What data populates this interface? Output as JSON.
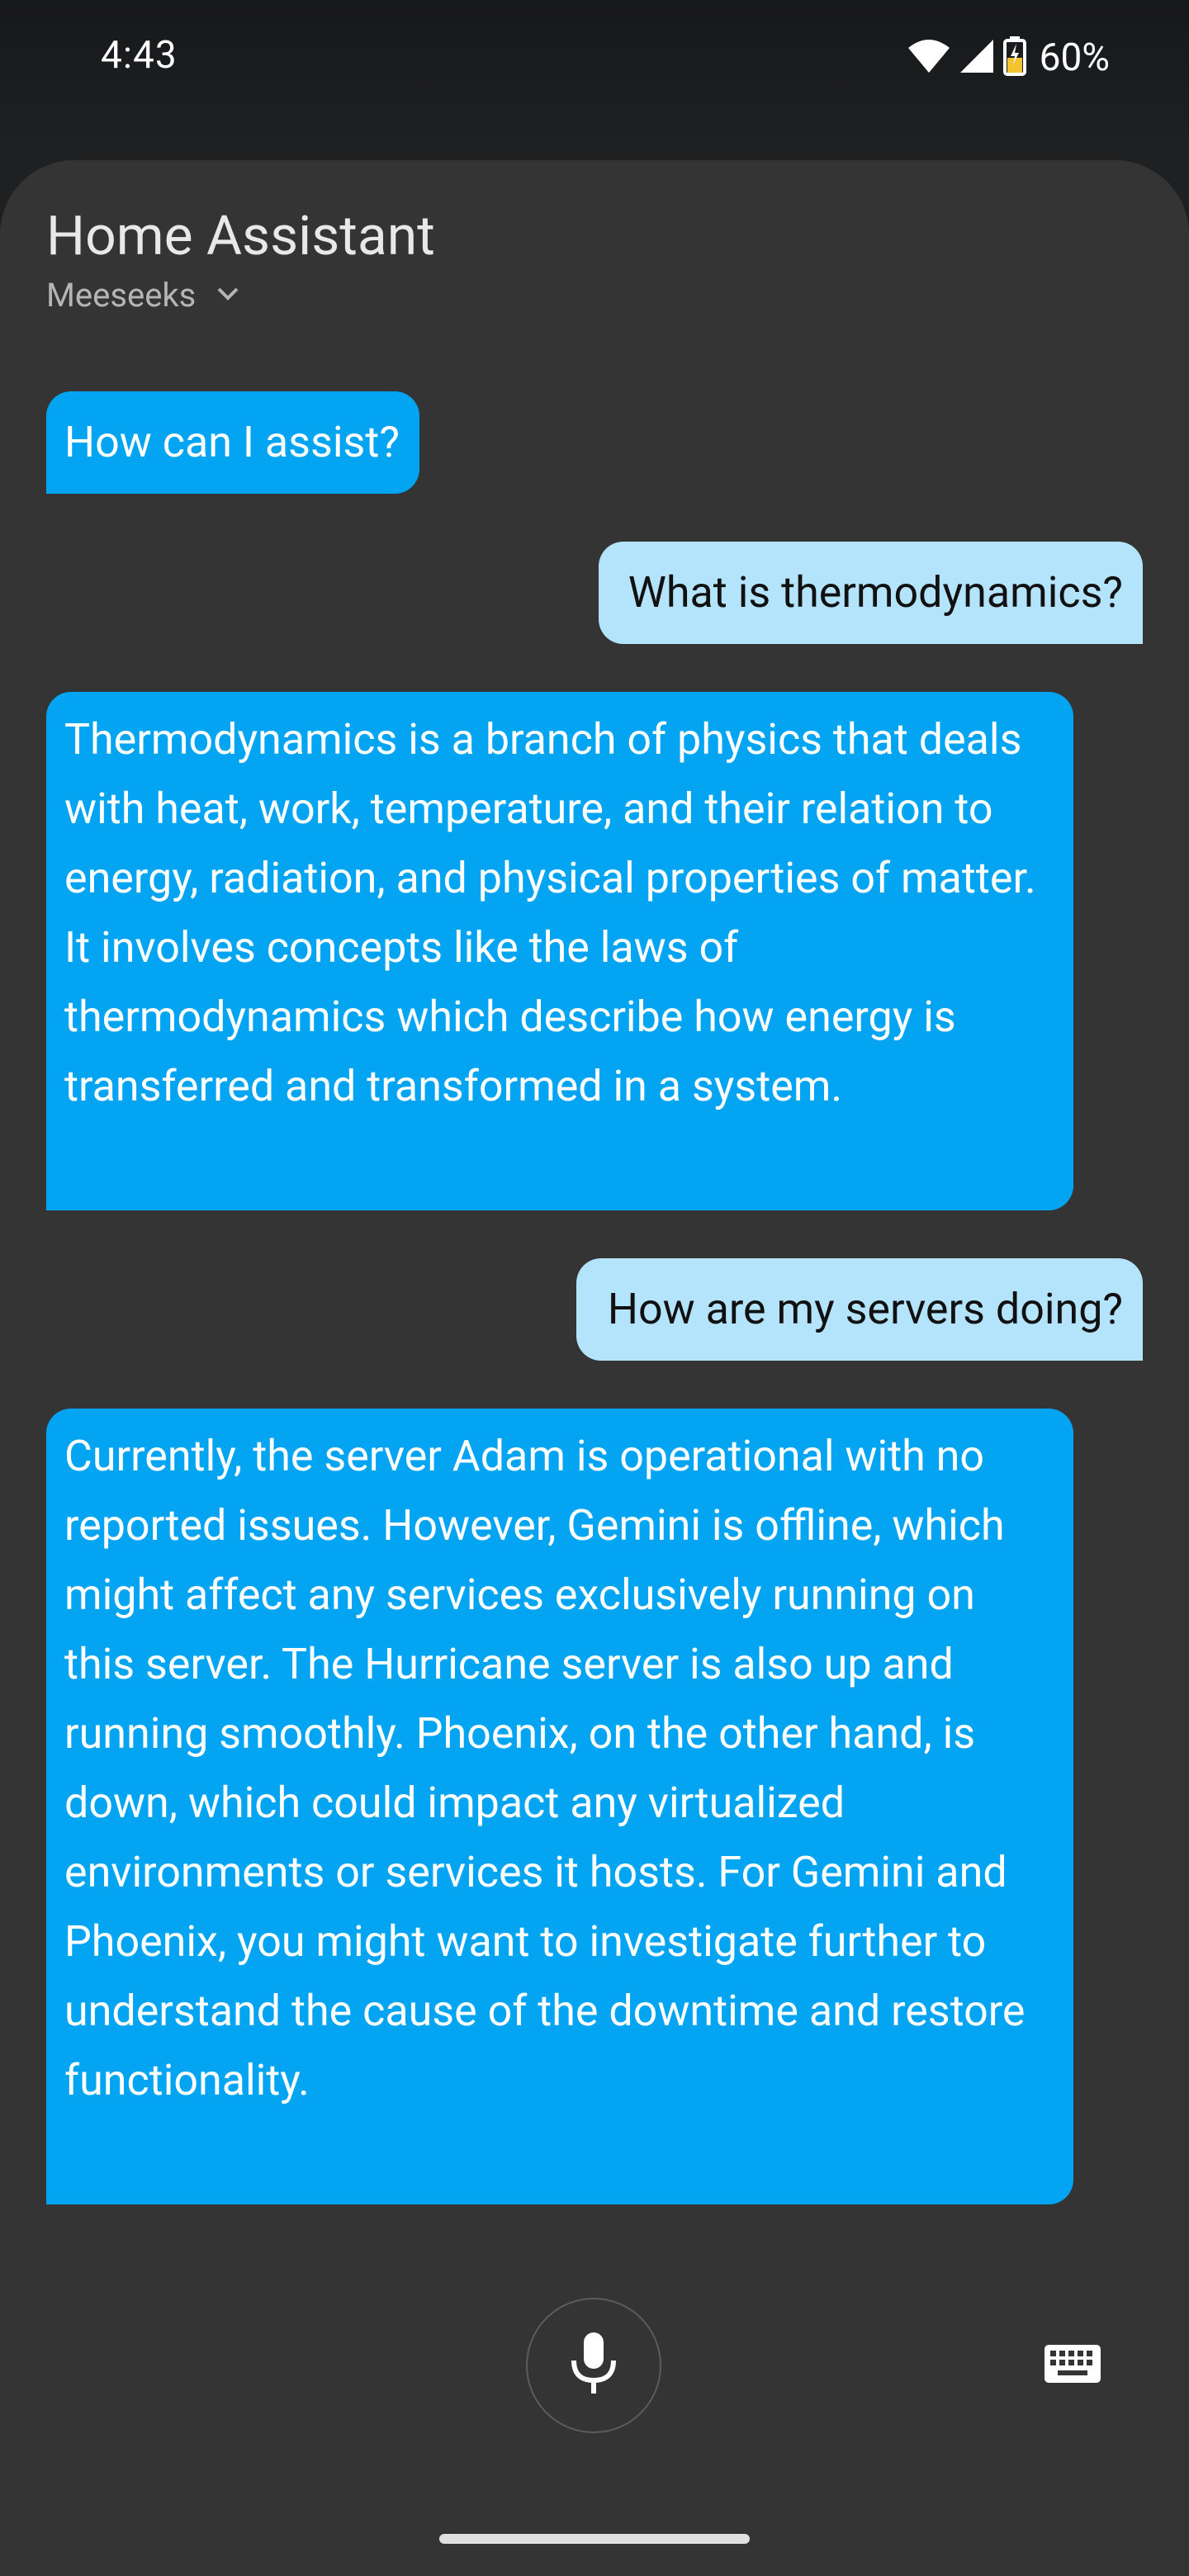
{
  "status_bar": {
    "time": "4:43",
    "battery_percent": "60%",
    "icons": [
      "wifi-icon",
      "cell-signal-icon",
      "battery-charging-icon"
    ]
  },
  "header": {
    "title": "Home Assistant",
    "pipeline": "Meeseeks",
    "dropdown_icon": "chevron-down-icon"
  },
  "conversation": [
    {
      "role": "assistant",
      "text": "How can I assist?"
    },
    {
      "role": "user",
      "text": "What is thermodynamics?"
    },
    {
      "role": "assistant",
      "text": "Thermodynamics is a branch of physics that deals with heat, work, temperature, and their relation to energy, radiation, and physical properties of matter. It involves concepts like the laws of thermodynamics which describe how energy is transferred and transformed in a system."
    },
    {
      "role": "user",
      "text": "How are my servers doing?"
    },
    {
      "role": "assistant",
      "text": "Currently, the server Adam is operational with no reported issues. However, Gemini is offline, which might affect any services exclusively running on this server. The Hurricane server is also up and running smoothly. Phoenix, on the other hand, is down, which could impact any virtualized environments or services it hosts. For Gemini and Phoenix, you might want to investigate further to understand the cause of the downtime and restore functionality."
    }
  ],
  "controls": {
    "mic_icon": "microphone-icon",
    "keyboard_icon": "keyboard-icon"
  },
  "colors": {
    "assistant_bubble": "#03a4f1",
    "user_bubble": "#b4e4fb",
    "sheet_background": "#343434"
  }
}
